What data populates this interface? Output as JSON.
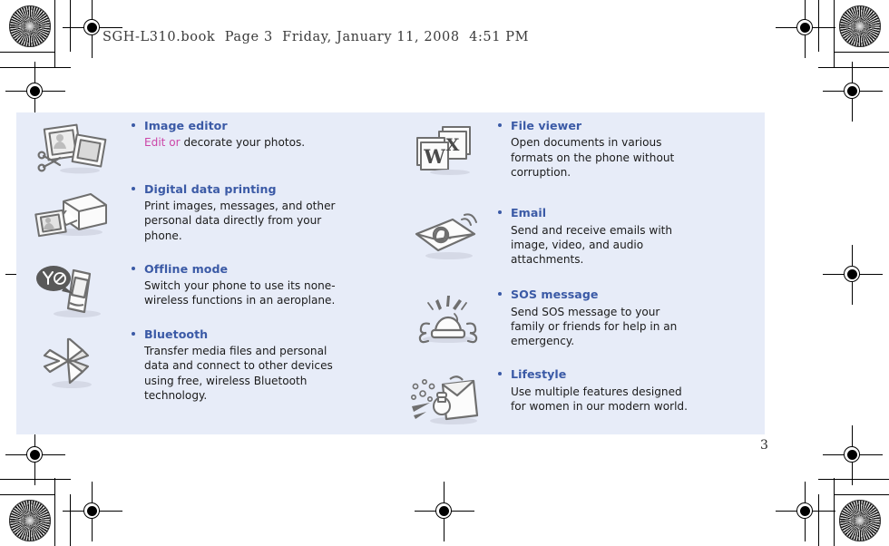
{
  "document": {
    "running_header": "SGH-L310.book  Page 3  Friday, January 11, 2008  4:51 PM",
    "page_number": "3"
  },
  "theme": {
    "panel_background": "#e7ecf8",
    "heading_color": "#3b5aa6",
    "body_text_color": "#1b1b1b",
    "highlight_color": "#cc46a8",
    "icon_outline_color": "#6b6b6b",
    "page_background": "#ffffff"
  },
  "panel": {
    "columns": [
      {
        "name": "left-column",
        "features": [
          {
            "icon": "image-editor-icon",
            "title": "Image editor",
            "description_highlight": "Edit or ",
            "description": "decorate your photos."
          },
          {
            "icon": "printer-icon",
            "title": "Digital data printing",
            "description_highlight": "",
            "description": "Print images, messages, and other personal data directly from your phone."
          },
          {
            "icon": "offline-mode-icon",
            "title": "Offline mode",
            "description_highlight": "",
            "description": "Switch your phone to use its none-wireless functions in an aeroplane."
          },
          {
            "icon": "bluetooth-icon",
            "title": "Bluetooth",
            "description_highlight": "",
            "description": "Transfer media files and personal data and connect to other devices using free, wireless Bluetooth technology."
          }
        ]
      },
      {
        "name": "right-column",
        "features": [
          {
            "icon": "file-viewer-icon",
            "title": "File viewer",
            "description_highlight": "",
            "description": "Open documents in various formats on the phone without corruption."
          },
          {
            "icon": "email-icon",
            "title": "Email",
            "description_highlight": "",
            "description": "Send and receive emails with image, video, and audio attachments."
          },
          {
            "icon": "sos-message-icon",
            "title": "SOS message",
            "description_highlight": "",
            "description": "Send SOS message to your family or friends for help in an emergency."
          },
          {
            "icon": "lifestyle-icon",
            "title": "Lifestyle",
            "description_highlight": "",
            "description": "Use multiple features designed for women in our modern world."
          }
        ]
      }
    ]
  },
  "print_marks": {
    "registration_targets": 8,
    "density_patches": 4,
    "trim_rules": "corner trim and bleed rules"
  }
}
